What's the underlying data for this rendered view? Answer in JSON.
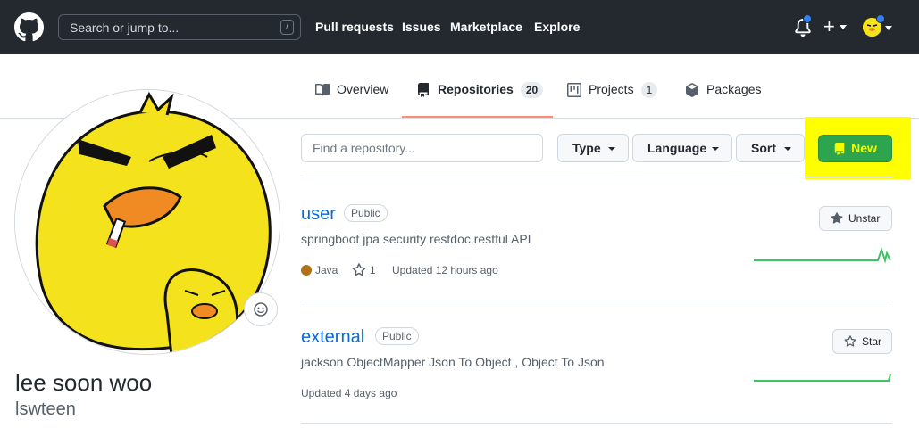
{
  "header": {
    "search_placeholder": "Search or jump to...",
    "search_shortcut": "/",
    "nav": [
      "Pull requests",
      "Issues",
      "Marketplace",
      "Explore"
    ],
    "plus": "+"
  },
  "tabs": [
    {
      "label": "Overview",
      "icon": "book-icon"
    },
    {
      "label": "Repositories",
      "icon": "repo-icon",
      "count": "20",
      "selected": true
    },
    {
      "label": "Projects",
      "icon": "project-icon",
      "count": "1"
    },
    {
      "label": "Packages",
      "icon": "package-icon"
    }
  ],
  "profile": {
    "name": "lee soon woo",
    "login": "lswteen"
  },
  "filters": {
    "find_placeholder": "Find a repository...",
    "type_label": "Type",
    "language_label": "Language",
    "sort_label": "Sort",
    "new_label": "New"
  },
  "repos": [
    {
      "name": "user",
      "visibility": "Public",
      "description": "springboot jpa security restdoc restful API",
      "language": "Java",
      "language_color": "#b07219",
      "stars": "1",
      "updated": "Updated 12 hours ago",
      "star_button": "Unstar"
    },
    {
      "name": "external",
      "visibility": "Public",
      "description": "jackson ObjectMapper Json To Object , Object To Json",
      "updated": "Updated 4 days ago",
      "star_button": "Star"
    }
  ],
  "colors": {
    "header_bg": "#24292f",
    "link": "#0969da",
    "new_button": "#2da44e",
    "highlight": "#ffff00",
    "tab_underline": "#fd8c73",
    "activity_line": "#40c463"
  }
}
